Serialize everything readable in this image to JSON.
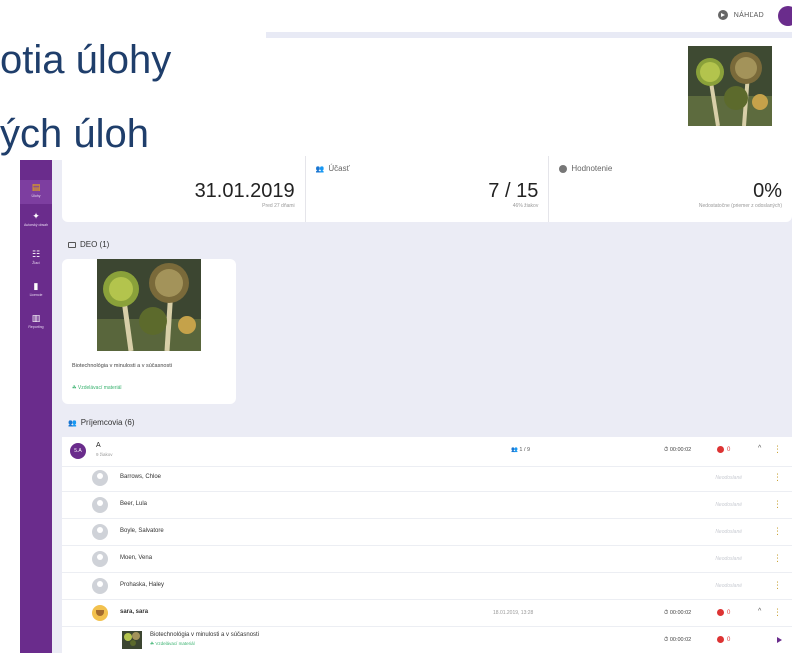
{
  "overlay": {
    "line1": "",
    "line2": "otia úlohy",
    "line3": "ých úloh"
  },
  "topbar": {
    "preview_label": "NÁHĽAD"
  },
  "sidebar": {
    "items": [
      {
        "glyph": "▤",
        "label": "Úlohy"
      },
      {
        "glyph": "✦",
        "label": "Autorský obsah"
      },
      {
        "glyph": "☷",
        "label": "Žiaci"
      },
      {
        "glyph": "▮",
        "label": "Licencie"
      },
      {
        "glyph": "▥",
        "label": "Reporting"
      }
    ]
  },
  "stats": {
    "deadline": {
      "value": "31.01.2019",
      "sub": "Pred 27 dňami"
    },
    "participation": {
      "label": "Účasť",
      "value": "7 / 15",
      "sub": "46% žiakov"
    },
    "rating": {
      "label": "Hodnotenie",
      "value": "0%",
      "sub": "Nedostatočne (priemer z odoslaných)"
    }
  },
  "deo": {
    "title": "DEO (1)",
    "card_title": "Biotechnológia v minulosti a v súčasnosti",
    "card_tag": "Vzdelávací materiál"
  },
  "recipients": {
    "title": "Príjemcovia (6)",
    "group": {
      "badge": "5.A",
      "name": "A",
      "sub": "9 žiakov",
      "count": "1 / 9",
      "time": "00:00:02",
      "errors": "0"
    },
    "students": [
      {
        "name": "Barrows, Chloe",
        "status": "Neodoslané"
      },
      {
        "name": "Beer, Lula",
        "status": "Neodoslané"
      },
      {
        "name": "Boyle, Salvatore",
        "status": "Neodoslané"
      },
      {
        "name": "Moen, Vena",
        "status": "Neodoslané"
      },
      {
        "name": "Prohaska, Haley",
        "status": "Neodoslané"
      }
    ],
    "submitted": {
      "name": "sara, sara",
      "date": "18.01.2019, 13:28",
      "time": "00:00:02",
      "errors": "0"
    },
    "material": {
      "title": "Biotechnológia v minulosti a v súčasnosti",
      "tag": "Vzdelávací materiál",
      "time": "00:00:02",
      "errors": "0"
    }
  },
  "colors": {
    "accent": "#6a2c8c",
    "background": "#ebecf5",
    "error": "#dd3333",
    "success": "#3cb371"
  }
}
